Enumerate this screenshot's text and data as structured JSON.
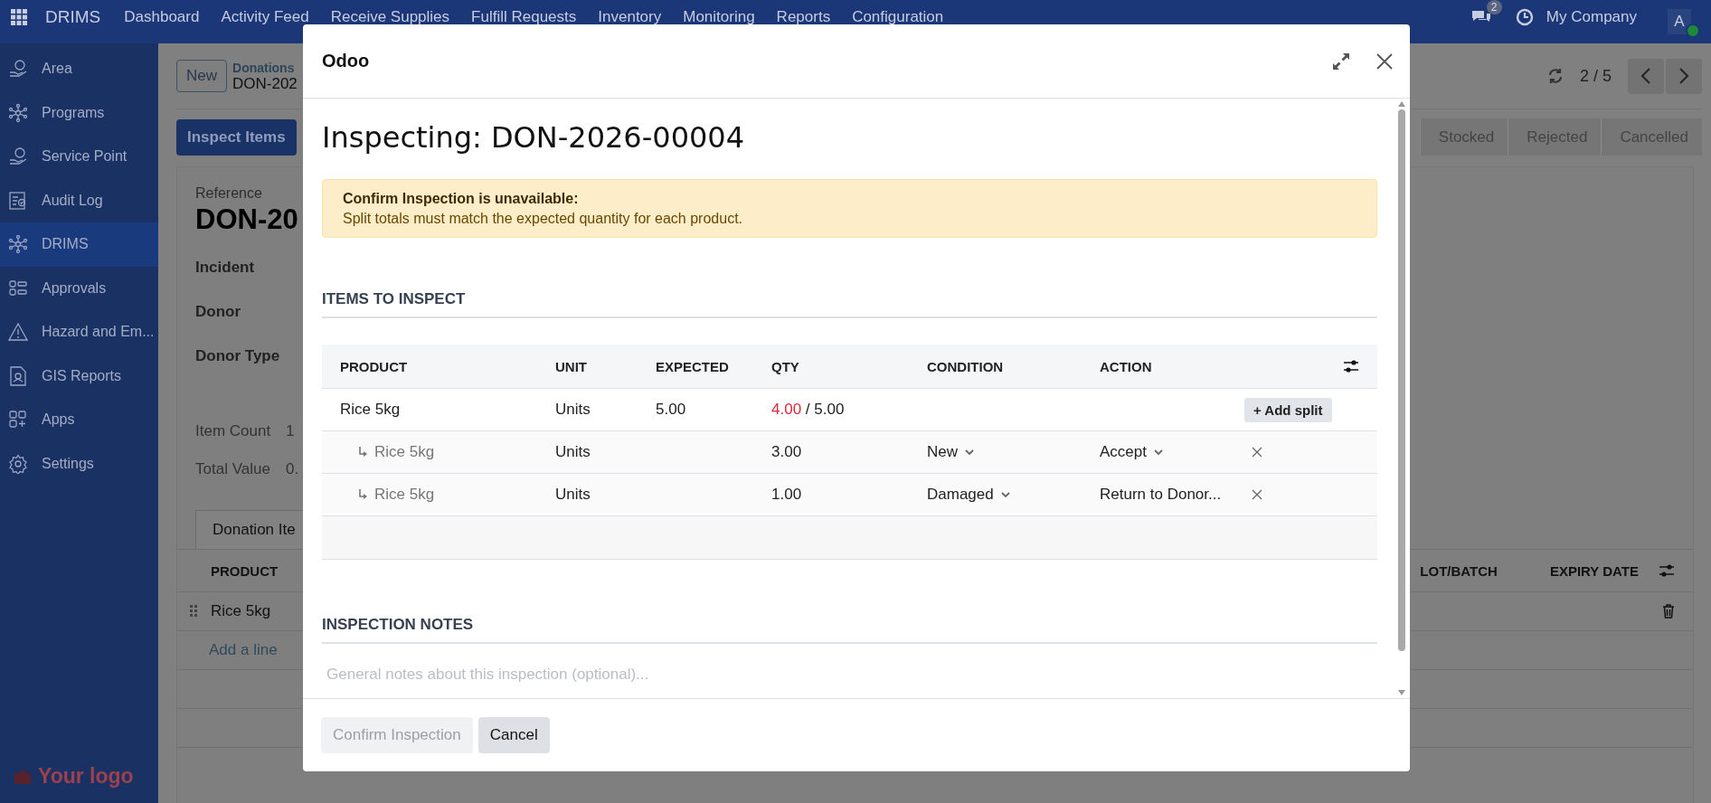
{
  "navbar": {
    "app_name": "DRIMS",
    "menu": [
      "Dashboard",
      "Activity Feed",
      "Receive Supplies",
      "Fulfill Requests",
      "Inventory",
      "Monitoring",
      "Reports",
      "Configuration"
    ],
    "chat_badge": "2",
    "company": "My Company",
    "avatar": "A",
    "avatar_online": true
  },
  "sidebar": {
    "items": [
      {
        "label": "Area",
        "selected": false
      },
      {
        "label": "Programs",
        "selected": false
      },
      {
        "label": "Service Point",
        "selected": false
      },
      {
        "label": "Audit Log",
        "selected": false
      },
      {
        "label": "DRIMS",
        "selected": true
      },
      {
        "label": "Approvals",
        "selected": false
      },
      {
        "label": "Hazard and Em...",
        "selected": false
      },
      {
        "label": "GIS Reports",
        "selected": false
      },
      {
        "label": "Apps",
        "selected": false
      },
      {
        "label": "Settings",
        "selected": false
      }
    ],
    "logo": "Your logo"
  },
  "control_panel": {
    "new_button": "New",
    "breadcrumb_parent": "Donations",
    "breadcrumb_current": "DON-202",
    "pager": "2 / 5",
    "action_button": "Inspect Items",
    "status_bar": [
      {
        "label": "Stocked",
        "selected": false
      },
      {
        "label": "Rejected",
        "selected": false
      },
      {
        "label": "Cancelled",
        "selected": false
      }
    ]
  },
  "form": {
    "reference_label": "Reference",
    "reference": "DON-20",
    "fields": [
      "Incident",
      "Donor",
      "Donor Type"
    ],
    "summary": [
      {
        "label": "Item Count",
        "value": "1"
      },
      {
        "label": "Total Value",
        "value": "0."
      }
    ],
    "tabs": [
      {
        "label": "Donation Ite",
        "selected": true
      }
    ],
    "columns": [
      "PRODUCT",
      "LOT/BATCH",
      "EXPIRY DATE"
    ],
    "rows": [
      {
        "product": "Rice 5kg"
      }
    ],
    "add_line": "Add a line"
  },
  "dialog": {
    "title": "Odoo",
    "heading": "Inspecting: DON-2026-00004",
    "alert": {
      "title": "Confirm Inspection is unavailable:",
      "text": "Split totals must match the expected quantity for each product."
    },
    "items_heading": "ITEMS TO INSPECT",
    "columns": [
      "PRODUCT",
      "UNIT",
      "EXPECTED",
      "QTY",
      "CONDITION",
      "ACTION"
    ],
    "rows": [
      {
        "kind": "line",
        "product": "Rice 5kg",
        "unit": "Units",
        "expected": "5.00",
        "qty": "4.00",
        "qty_total": "/ 5.00",
        "mismatch": true,
        "button": "+ Add split"
      },
      {
        "kind": "split",
        "product": "Rice 5kg",
        "unit": "Units",
        "qty": "3.00",
        "condition": "New",
        "action": "Accept"
      },
      {
        "kind": "split",
        "product": "Rice 5kg",
        "unit": "Units",
        "qty": "1.00",
        "condition": "Damaged",
        "action": "Return to Donor..."
      }
    ],
    "notes_heading": "INSPECTION NOTES",
    "notes": {
      "placeholder": "General notes about this inspection (optional)..."
    },
    "buttons": [
      {
        "label": "Confirm Inspection",
        "disabled": true
      },
      {
        "label": "Cancel",
        "disabled": false
      }
    ]
  }
}
